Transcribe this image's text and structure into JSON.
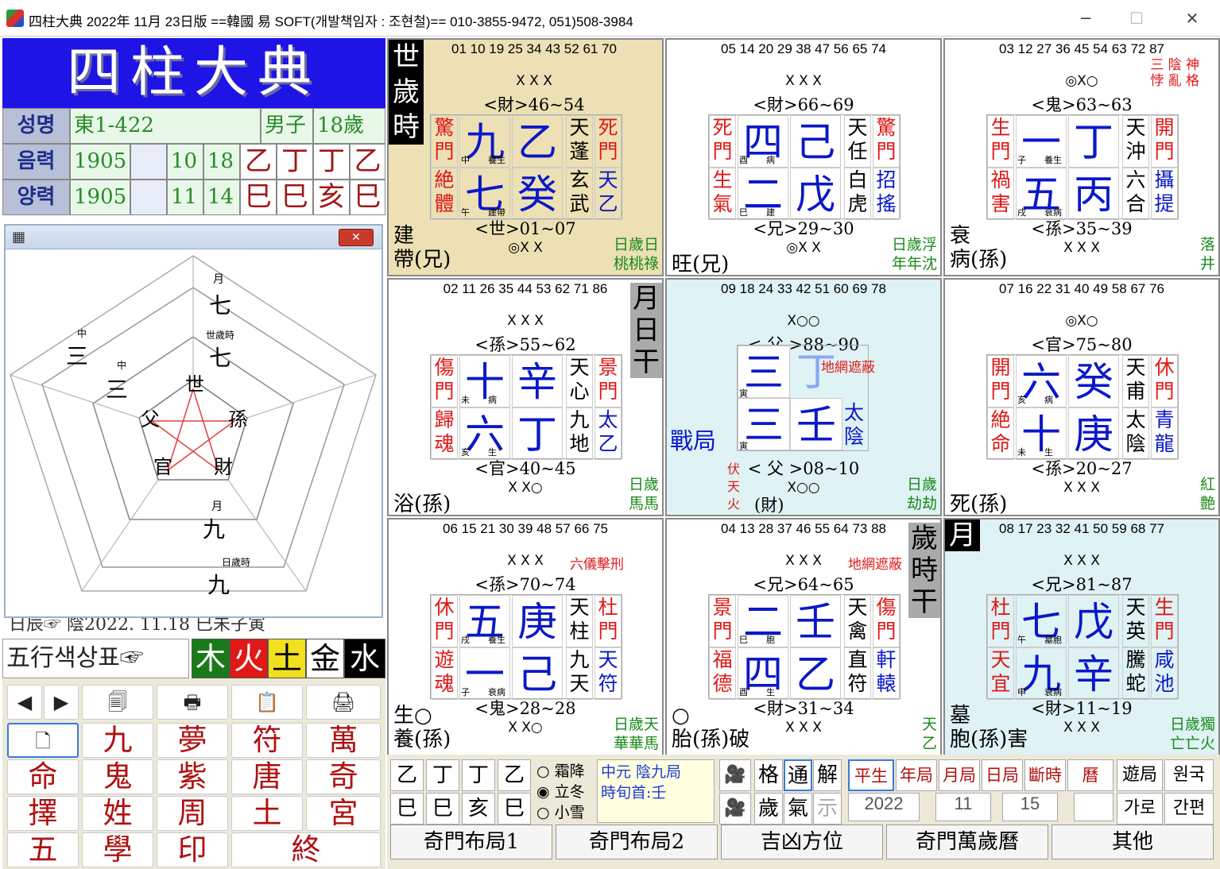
{
  "window": {
    "title": "四柱大典 2022年 11月 23日版 ==韓國 易 SOFT(개발책임자 : 조현철)== 010-3855-9472, 051)508-3984",
    "minimize": "─",
    "maximize": "☐",
    "close": "✕"
  },
  "banner": "四柱大典",
  "info": {
    "name_label": "성명",
    "name_value": "東1-422",
    "gender": "男子",
    "age": "18歲",
    "lunar_label": "음력",
    "lunar_year": "1905",
    "lunar_month": "10",
    "lunar_day": "18",
    "solar_label": "양력",
    "solar_year": "1905",
    "solar_month": "11",
    "solar_day": "14",
    "gan": [
      "乙",
      "丁",
      "丁",
      "乙"
    ],
    "zhi": [
      "巳",
      "巳",
      "亥",
      "巳"
    ]
  },
  "popup": {
    "icon": "▦",
    "close": "✕",
    "outer": {
      "top_small": "月",
      "top": "七",
      "left_small": "中",
      "left": "三",
      "bottom_small": "日歲時",
      "bottom": "九"
    },
    "mid": {
      "top_small": "世歲時",
      "top": "七",
      "left_small": "中",
      "left": "三",
      "bottom_small": "月",
      "bottom": "九"
    },
    "inner": [
      "世",
      "孫",
      "財",
      "官",
      "父"
    ]
  },
  "wuxing": {
    "label": "五行색상표☞",
    "elements": [
      {
        "t": "木",
        "bg": "#1a7a1a",
        "fg": "#fff"
      },
      {
        "t": "火",
        "bg": "#e01818",
        "fg": "#fff"
      },
      {
        "t": "土",
        "bg": "#f0e020",
        "fg": "#000"
      },
      {
        "t": "金",
        "bg": "#fff",
        "fg": "#000"
      },
      {
        "t": "水",
        "bg": "#000",
        "fg": "#fff"
      }
    ]
  },
  "behind_row": "日辰☞ 陰2022. 11.18 巳未子寅",
  "buttons": {
    "row1": [
      "◀",
      "▶",
      "🗐",
      "🖶",
      "📋",
      "🖨"
    ],
    "row2": [
      "🗋",
      "九",
      "夢",
      "符",
      "萬"
    ],
    "row3": [
      "命",
      "鬼",
      "紫",
      "唐",
      "奇"
    ],
    "row4": [
      "擇",
      "姓",
      "周",
      "土",
      "宮"
    ],
    "row5": [
      "五",
      "學",
      "印",
      "終"
    ]
  },
  "cells": [
    {
      "id": "c1",
      "nums": "01 10 19 25 34 43 52 61 70",
      "marks": "X X X",
      "role": "<財>46~54",
      "role2": "<世>01~07",
      "marks2": "◎X X",
      "bl": [
        "建",
        "帶(兄)"
      ],
      "br": [
        "日歲日",
        "桃桃祿"
      ],
      "lt": "驚\n門",
      "lb": "絶\n體",
      "rt": "天\n蓬",
      "rb": "玄\n武",
      "rrt": "死\n門",
      "rrb": "天\n乙",
      "n1": "九",
      "g1": "乙",
      "n2": "七",
      "g2": "癸",
      "s1": "中",
      "s2": "養生",
      "s3": "午",
      "s4": "建帶",
      "tag": "世\n歲\n時"
    },
    {
      "id": "c2",
      "nums": "05 14 20 29 38 47 56 65 74",
      "marks": "X X X",
      "role": "<財>66~69",
      "role2": "<兄>29~30",
      "marks2": "◎X X",
      "bl": [
        "旺(兄)"
      ],
      "br": [
        "日歲浮",
        "年年沈"
      ],
      "lt": "死\n門",
      "lb": "生\n氣",
      "rt": "天\n任",
      "rb": "白\n虎",
      "rrt": "驚\n門",
      "rrb": "招\n搖",
      "n1": "四",
      "g1": "己",
      "n2": "二",
      "g2": "戊",
      "s1": "酉",
      "s2": "病",
      "s3": "巳",
      "s4": "建"
    },
    {
      "id": "c3",
      "nums": "03 12 27 36 45 54 63 72 87",
      "marks": "◎X○",
      "role": "<鬼>63~63",
      "role2": "<孫>35~39",
      "marks2": "X X X",
      "bl": [
        "衰",
        "病(孫)"
      ],
      "br": [
        "落",
        "井"
      ],
      "top_right": "三 陰 神\n悖 亂 格",
      "lt": "生\n門",
      "lb": "禍\n害",
      "rt": "天\n沖",
      "rb": "六\n合",
      "rrt": "開\n門",
      "rrb": "攝\n提",
      "n1": "一",
      "g1": "丁",
      "n2": "五",
      "g2": "丙",
      "s1": "子",
      "s2": "養生",
      "s3": "戌",
      "s4": "衰病"
    },
    {
      "id": "c4",
      "nums": "02 11 26 35 44 53 62 71 86",
      "marks": "X X X",
      "role": "<孫>55~62",
      "role2": "<官>40~45",
      "marks2": "X X○",
      "bl": [
        "浴(孫)"
      ],
      "br": [
        "日歲",
        "馬馬"
      ],
      "gtag": "月\n日\n干",
      "lt": "傷\n門",
      "lb": "歸\n魂",
      "rt": "天\n心",
      "rb": "九\n地",
      "rrt": "景\n門",
      "rrb": "太\n乙",
      "n1": "十",
      "g1": "辛",
      "n2": "六",
      "g2": "丁",
      "s1": "未",
      "s2": "病",
      "s3": "亥",
      "s4": "生"
    },
    {
      "id": "c5",
      "nums": "09 18 24 33 42 51 60 69 78",
      "marks": "X○○",
      "role": "< 父 >88~90",
      "role2": "< 父 >08~10",
      "marks2": "X○○",
      "center_note": "地網遮蔽",
      "war": "戰局",
      "fu": "伏\n天\n火",
      "br": [
        "日歲",
        "劫劫"
      ],
      "cai": "(財)",
      "n1": "三",
      "g1": "丁",
      "n2": "三",
      "g2": "壬",
      "taiyin": "太\n陰",
      "s1": "寅",
      "s3": "寅"
    },
    {
      "id": "c6",
      "nums": "07 16 22 31 40 49 58 67 76",
      "marks": "◎X○",
      "role": "<官>75~80",
      "role2": "<孫>20~27",
      "marks2": "X X X",
      "bl": [
        "死(孫)"
      ],
      "br": [
        "紅",
        "艶"
      ],
      "lt": "開\n門",
      "lb": "絶\n命",
      "rt": "天\n甫",
      "rb": "太\n陰",
      "rrt": "休\n門",
      "rrb": "青\n龍",
      "n1": "六",
      "g1": "癸",
      "n2": "十",
      "g2": "庚",
      "s1": "亥",
      "s2": "病",
      "s3": "未",
      "s4": "生"
    },
    {
      "id": "c7",
      "nums": "06 15 21 30 39 48 57 66 75",
      "marks": "X X X",
      "role": "<孫>70~74",
      "role2": "<鬼>28~28",
      "marks2": "X X○",
      "note": "六儀擊刑",
      "bl": [
        "生○",
        "養(孫)"
      ],
      "br": [
        "日歲天",
        "華華馬"
      ],
      "lt": "休\n門",
      "lb": "遊\n魂",
      "rt": "天\n柱",
      "rb": "九\n天",
      "rrt": "杜\n門",
      "rrb": "天\n符",
      "n1": "五",
      "g1": "庚",
      "n2": "一",
      "g2": "己",
      "s1": "戌",
      "s2": "養生",
      "s3": "子",
      "s4": "衰病"
    },
    {
      "id": "c8",
      "nums": "04 13 28 37 46 55 64 73 88",
      "marks": "X X X",
      "role": "<兄>64~65",
      "role2": "<財>31~34",
      "marks2": "X X X",
      "note": "地網遮蔽",
      "bl": [
        "○",
        "胎(孫)破"
      ],
      "br": [
        "天",
        "乙"
      ],
      "gtag": "歲\n時\n干",
      "lt": "景\n門",
      "lb": "福\n德",
      "rt": "天\n禽",
      "rb": "直\n符",
      "rrt": "傷\n門",
      "rrb": "軒\n轅",
      "n1": "二",
      "g1": "壬",
      "n2": "四",
      "g2": "乙",
      "s1": "巳",
      "s2": "胞",
      "s3": "酉",
      "s4": "生"
    },
    {
      "id": "c9",
      "nums": "08 17 23 32 41 50 59 68 77",
      "marks": "X X X",
      "role": "<兄>81~87",
      "role2": "<財>11~19",
      "marks2": "X X X",
      "bl": [
        "墓",
        "胞(孫)害"
      ],
      "br": [
        "日歲獨",
        "亡亡火"
      ],
      "tag": "月",
      "lt": "杜\n門",
      "lb": "天\n宜",
      "rt": "天\n英",
      "rb": "騰\n蛇",
      "rrt": "生\n門",
      "rrb": "咸\n池",
      "n1": "七",
      "g1": "戊",
      "n2": "九",
      "g2": "辛",
      "s1": "午",
      "s2": "墓胞",
      "s3": "申",
      "s4": "衰病"
    }
  ],
  "bottom": {
    "gan": [
      "乙",
      "丁",
      "丁",
      "乙"
    ],
    "zhi": [
      "巳",
      "巳",
      "亥",
      "巳"
    ],
    "terms": [
      "霜降",
      "立冬",
      "小雪"
    ],
    "yuan": "中元  陰九局",
    "xunshou": "時旬首:壬",
    "mid_btns": [
      "格",
      "通",
      "解",
      "歲",
      "氣",
      "示"
    ],
    "ju_btns": [
      "平生",
      "年局",
      "月局",
      "日局",
      "斷時",
      "曆"
    ],
    "year": "2022",
    "month": "11",
    "day": "15",
    "right_btns": [
      "遊局",
      "원국",
      "가로",
      "간편"
    ],
    "tabs": [
      "奇門布局1",
      "奇門布局2",
      "吉凶方位",
      "奇門萬歲曆",
      "其他"
    ]
  }
}
